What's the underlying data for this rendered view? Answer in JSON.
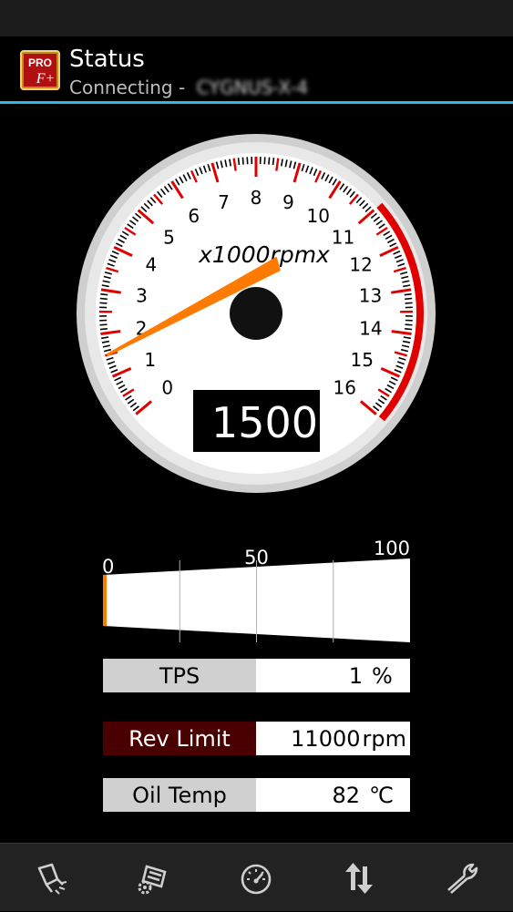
{
  "appbar": {
    "title": "Status",
    "subtitle_prefix": "Connecting - ",
    "device_name": "CYGNUS-X-4",
    "icon_top_text": "PRO",
    "icon_bottom_text": "F+"
  },
  "gauge": {
    "unit_label": "x1000rpmx",
    "tick_labels": [
      "0",
      "1",
      "2",
      "3",
      "4",
      "5",
      "6",
      "7",
      "8",
      "9",
      "10",
      "11",
      "12",
      "13",
      "14",
      "15",
      "16"
    ],
    "min": 0,
    "max": 16,
    "redline_start": 11,
    "needle_value": 1.5,
    "digital_readout": "1500"
  },
  "throttle_bar": {
    "labels": [
      "0",
      "50",
      "100"
    ],
    "value_percent": 1
  },
  "readouts": {
    "tps": {
      "label": "TPS",
      "value": "1",
      "unit": "%"
    },
    "rev_limit": {
      "label": "Rev Limit",
      "value": "11000",
      "unit": "rpm"
    },
    "oil_temp": {
      "label": "Oil Temp",
      "value": "82",
      "unit": "℃"
    }
  },
  "nav": [
    "diagnostic-icon",
    "settings-gear-icon",
    "speedometer-icon",
    "data-transfer-icon",
    "wrench-icon"
  ],
  "colors": {
    "accent": "#33b5e5",
    "redline": "#e00000",
    "needle": "#ff7a00",
    "rev_limit_bg": "#4a0000",
    "label_bg": "#d0d0d0"
  }
}
